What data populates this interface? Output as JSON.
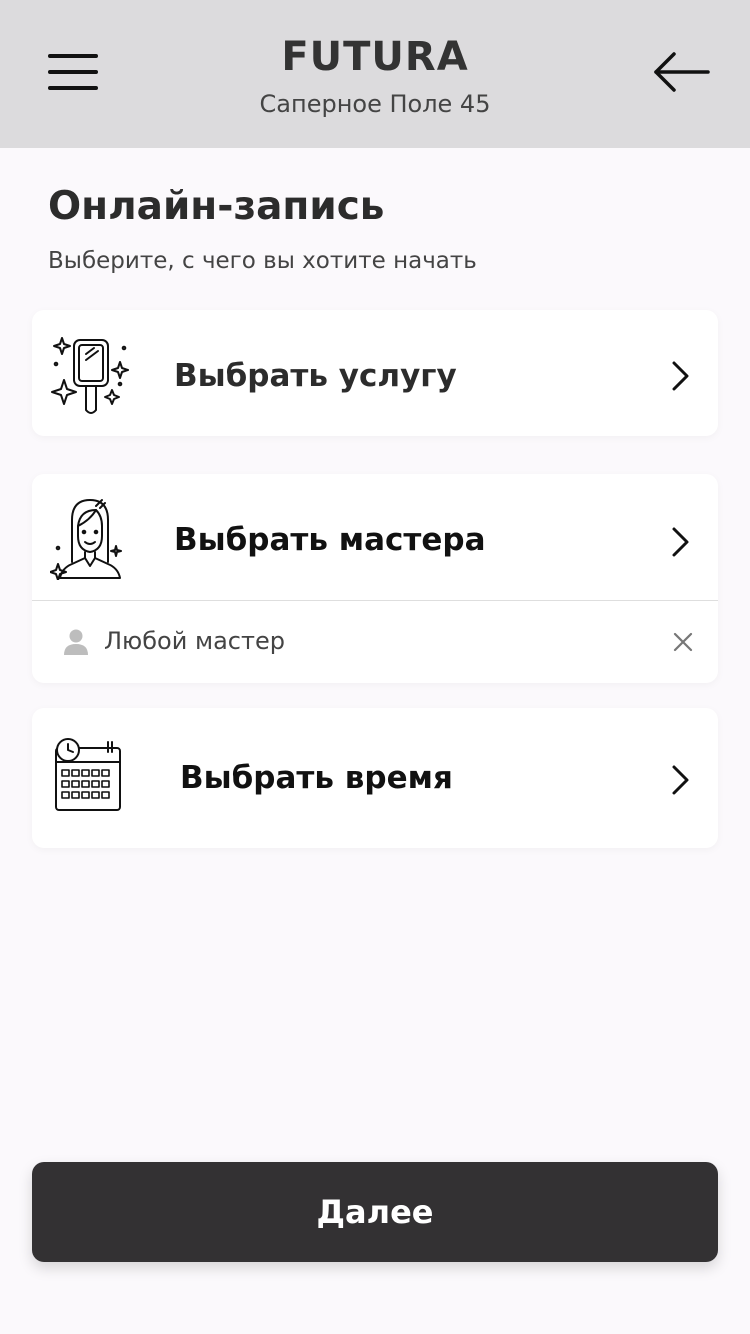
{
  "header": {
    "title": "FUTURA",
    "subtitle": "Саперное Поле 45",
    "menu_icon": "hamburger-icon",
    "back_icon": "arrow-left-icon"
  },
  "page": {
    "title": "Онлайн-запись",
    "subtitle": "Выберите, с чего вы хотите начать"
  },
  "options": {
    "service": {
      "label": "Выбрать услугу",
      "icon": "hand-mirror-sparkles-icon"
    },
    "master": {
      "label": "Выбрать мастера",
      "icon": "woman-portrait-icon",
      "selected": "Любой мастер"
    },
    "time": {
      "label": "Выбрать время",
      "icon": "calendar-clock-icon"
    }
  },
  "footer": {
    "next_label": "Далее"
  },
  "colors": {
    "header_bg": "#dcdbdd",
    "page_bg": "#fbf9fc",
    "button_bg": "#333133"
  }
}
